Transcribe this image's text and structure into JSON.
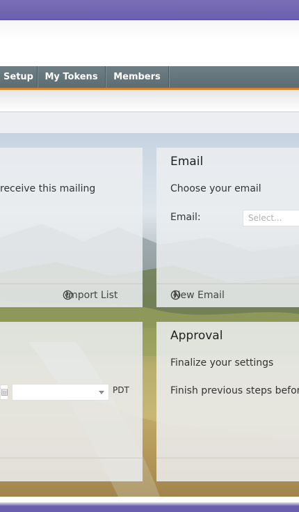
{
  "nav": {
    "items": [
      "Setup",
      "My Tokens",
      "Members"
    ]
  },
  "recipients_panel": {
    "text": "receive this mailing",
    "import_link": "Import List",
    "import_icon": "power-icon"
  },
  "email_panel": {
    "title": "Email",
    "subtitle": "Choose your email",
    "field_label": "Email:",
    "select_placeholder": "Select...",
    "new_link": "New Email",
    "new_icon": "plus-circle-icon"
  },
  "schedule_panel": {
    "timezone": "PDT",
    "calendar_icon": "calendar-icon",
    "time_select_icon": "chevron-down-icon"
  },
  "approval_panel": {
    "title": "Approval",
    "subtitle": "Finalize your settings",
    "note": "Finish previous steps before"
  },
  "colors": {
    "top_strip": "#6a5fae",
    "nav_bg": "#5c6c73",
    "nav_accent": "#d9822b"
  }
}
